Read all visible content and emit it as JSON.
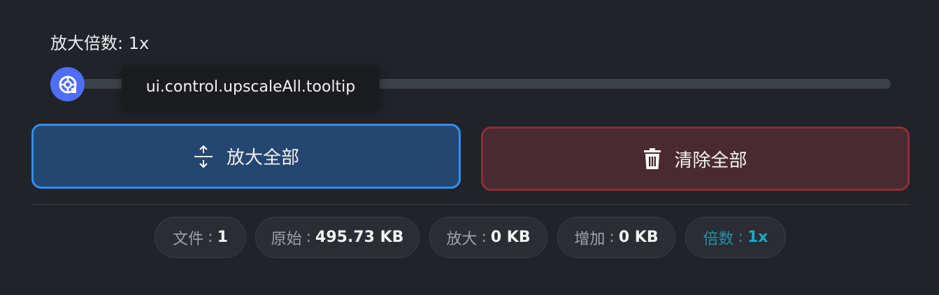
{
  "scale": {
    "label": "放大倍数: 1x",
    "value": 1
  },
  "tooltip": {
    "text": "ui.control.upscaleAll.tooltip"
  },
  "buttons": {
    "upscale_all": "放大全部",
    "clear_all": "清除全部"
  },
  "stats": {
    "files": {
      "label": "文件",
      "value": "1"
    },
    "original": {
      "label": "原始",
      "value": "495.73 KB"
    },
    "upscaled": {
      "label": "放大",
      "value": "0 KB"
    },
    "increase": {
      "label": "增加",
      "value": "0 KB"
    },
    "factor": {
      "label": "倍数",
      "value": "1x"
    }
  },
  "colors": {
    "background": "#202329",
    "accent_blue": "#2f8ef0",
    "danger_red": "#8b2f37",
    "thumb": "#4f6ef7",
    "factor_accent": "#1fa9c4"
  },
  "icons": {
    "slider_thumb": "lifebuoy-icon",
    "upscale": "expand-vertical-icon",
    "clear": "trash-icon"
  }
}
